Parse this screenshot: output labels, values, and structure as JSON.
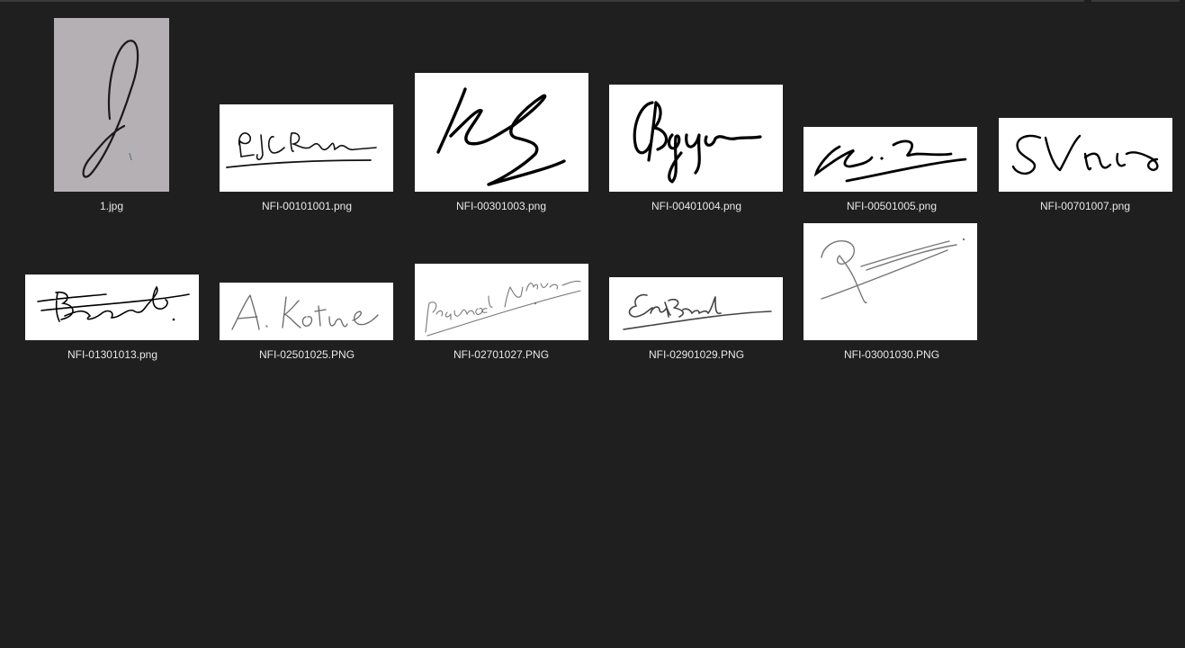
{
  "files": [
    {
      "name": "1.jpg",
      "thumb_icon": "signature-photo"
    },
    {
      "name": "NFI-00101001.png",
      "thumb_icon": "signature-image"
    },
    {
      "name": "NFI-00301003.png",
      "thumb_icon": "signature-image"
    },
    {
      "name": "NFI-00401004.png",
      "thumb_icon": "signature-image"
    },
    {
      "name": "NFI-00501005.png",
      "thumb_icon": "signature-image"
    },
    {
      "name": "NFI-00701007.png",
      "thumb_icon": "signature-image"
    },
    {
      "name": "NFI-01301013.png",
      "thumb_icon": "signature-image"
    },
    {
      "name": "NFI-02501025.PNG",
      "thumb_icon": "signature-image"
    },
    {
      "name": "NFI-02701027.PNG",
      "thumb_icon": "signature-image"
    },
    {
      "name": "NFI-02901029.PNG",
      "thumb_icon": "signature-image"
    },
    {
      "name": "NFI-03001030.PNG",
      "thumb_icon": "signature-image"
    }
  ],
  "colors": {
    "background": "#1f1f1f",
    "label": "#e8e8e8",
    "photo_paper": "#b5b0b3"
  }
}
